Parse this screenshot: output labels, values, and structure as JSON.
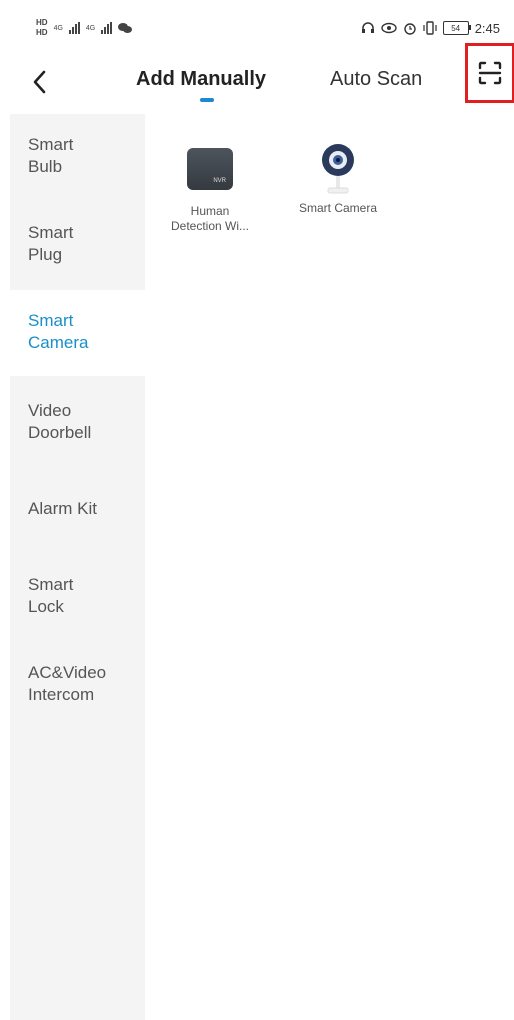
{
  "status_bar": {
    "sim1": "HD",
    "sim2": "HD",
    "network1": "4G",
    "network2": "4G",
    "battery": "54",
    "time": "2:45",
    "icons": [
      "wechat-icon",
      "headset-icon",
      "eye-icon",
      "alarm-icon",
      "vibrate-icon"
    ]
  },
  "nav": {
    "back_icon": "chevron-left-icon",
    "tab_manual": "Add Manually",
    "tab_auto": "Auto Scan",
    "scan_icon": "qr-scan-icon",
    "accent_color": "#1e88d0",
    "highlight_color": "#e02020"
  },
  "sidebar": {
    "items": [
      {
        "label": "Smart\nBulb"
      },
      {
        "label": "Smart\nPlug"
      },
      {
        "label": "Smart\nCamera",
        "active": true
      },
      {
        "label": "Video\nDoorbell"
      },
      {
        "label": "Alarm Kit"
      },
      {
        "label": "Smart\nLock"
      },
      {
        "label": "AC&Video\nIntercom"
      }
    ]
  },
  "devices": [
    {
      "label": "Human\nDetection Wi...",
      "icon": "nvr-box-icon",
      "badge": "NVR"
    },
    {
      "label": "Smart Camera",
      "icon": "camera-icon"
    }
  ]
}
